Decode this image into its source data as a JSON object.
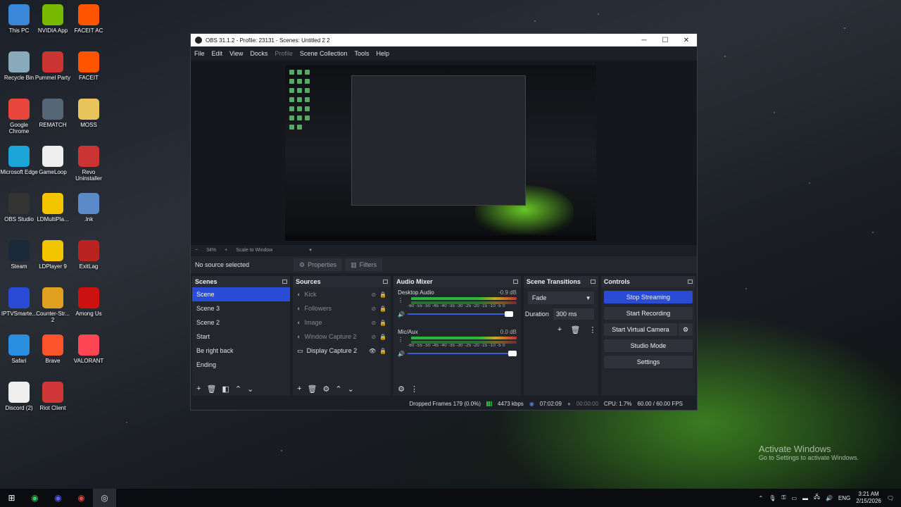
{
  "desktop": {
    "icons": [
      {
        "label": "This PC",
        "icon": "pc-icon",
        "color": "#3a86d8"
      },
      {
        "label": "NVIDIA App",
        "icon": "nvidia-icon",
        "color": "#76b900"
      },
      {
        "label": "FACEIT AC",
        "icon": "faceit-icon",
        "color": "#ff5500"
      },
      {
        "label": "Recycle Bin",
        "icon": "recycle-bin-icon",
        "color": "#8ab"
      },
      {
        "label": "Pummel Party",
        "icon": "pummel-party-icon",
        "color": "#c33"
      },
      {
        "label": "FACEIT",
        "icon": "faceit-icon",
        "color": "#ff5500"
      },
      {
        "label": "Google Chrome",
        "icon": "chrome-icon",
        "color": "#e8453c"
      },
      {
        "label": "REMATCH",
        "icon": "rematch-icon",
        "color": "#567"
      },
      {
        "label": "MOSS",
        "icon": "folder-icon",
        "color": "#e8c25a"
      },
      {
        "label": "Microsoft Edge",
        "icon": "edge-icon",
        "color": "#1ba4d8"
      },
      {
        "label": "GameLoop",
        "icon": "file-icon",
        "color": "#eee"
      },
      {
        "label": "Revo Uninstaller",
        "icon": "revo-icon",
        "color": "#c33"
      },
      {
        "label": "OBS Studio",
        "icon": "obs-icon",
        "color": "#333"
      },
      {
        "label": "LDMultiPla...",
        "icon": "ldplayer-icon",
        "color": "#f3c400"
      },
      {
        "label": ".lnk",
        "icon": "shortcut-icon",
        "color": "#5a8ac8"
      },
      {
        "label": "Steam",
        "icon": "steam-icon",
        "color": "#1b2838"
      },
      {
        "label": "LDPlayer 9",
        "icon": "ldplayer-icon",
        "color": "#f3c400"
      },
      {
        "label": "ExitLag",
        "icon": "exitlag-icon",
        "color": "#b22"
      },
      {
        "label": "IPTVSmarte...",
        "icon": "iptv-icon",
        "color": "#2a4bd6"
      },
      {
        "label": "Counter-Str... 2",
        "icon": "cs2-icon",
        "color": "#e0a020"
      },
      {
        "label": "Among Us",
        "icon": "among-us-icon",
        "color": "#c11"
      },
      {
        "label": "Safari",
        "icon": "safari-icon",
        "color": "#2a8ee0"
      },
      {
        "label": "Brave",
        "icon": "brave-icon",
        "color": "#fb542b"
      },
      {
        "label": "VALORANT",
        "icon": "valorant-icon",
        "color": "#ff4655"
      },
      {
        "label": "Discord (2)",
        "icon": "file-icon",
        "color": "#eee"
      },
      {
        "label": "Riot Client",
        "icon": "riot-icon",
        "color": "#d13639"
      }
    ],
    "watermark": {
      "line1": "Activate Windows",
      "line2": "Go to Settings to activate Windows."
    }
  },
  "window": {
    "title": "OBS 31.1.2 - Profile: 23131 - Scenes: Untitled 2 2",
    "controls": {
      "minimize": "─",
      "maximize": "☐",
      "close": "✕"
    }
  },
  "menu": {
    "file": "File",
    "edit": "Edit",
    "view": "View",
    "docks": "Docks",
    "profile": "Profile",
    "scene_collection": "Scene Collection",
    "tools": "Tools",
    "help": "Help"
  },
  "zoom": {
    "minus": "−",
    "level": "34%",
    "plus": "+",
    "mode": "Scale to Window"
  },
  "source_bar": {
    "no_source": "No source selected",
    "properties": "Properties",
    "filters": "Filters"
  },
  "scenes": {
    "title": "Scenes",
    "items": [
      "Scene",
      "Scene 3",
      "Scene 2",
      "Start",
      "Be right back",
      "Ending"
    ],
    "selected_index": 0
  },
  "sources": {
    "title": "Sources",
    "items": [
      {
        "name": "Kick",
        "visible": false
      },
      {
        "name": "Followers",
        "visible": false
      },
      {
        "name": "Image",
        "visible": false
      },
      {
        "name": "Window Capture 2",
        "visible": false
      },
      {
        "name": "Display Capture 2",
        "visible": true
      }
    ]
  },
  "mixer": {
    "title": "Audio Mixer",
    "channels": [
      {
        "name": "Desktop Audio",
        "db": "-0.9 dB",
        "level": 0.95
      },
      {
        "name": "Mic/Aux",
        "db": "0.0 dB",
        "level": 1.0
      }
    ],
    "scale": "-60 -55 -50 -45 -40 -35 -30 -25 -20 -15 -10 -5 0"
  },
  "transitions": {
    "title": "Scene Transitions",
    "selected": "Fade",
    "duration_label": "Duration",
    "duration_value": "300 ms"
  },
  "controls": {
    "title": "Controls",
    "stop_streaming": "Stop Streaming",
    "start_recording": "Start Recording",
    "start_virtual_camera": "Start Virtual Camera",
    "studio_mode": "Studio Mode",
    "settings": "Settings"
  },
  "status": {
    "dropped_frames": "Dropped Frames 179 (0.0%)",
    "bitrate": "4473 kbps",
    "stream_time": "07:02:09",
    "record_time": "00:00:00",
    "cpu": "CPU: 1.7%",
    "fps": "60.00 / 60.00 FPS"
  },
  "taskbar": {
    "lang": "ENG",
    "time": "3:21 AM",
    "date": "2/15/2026"
  }
}
